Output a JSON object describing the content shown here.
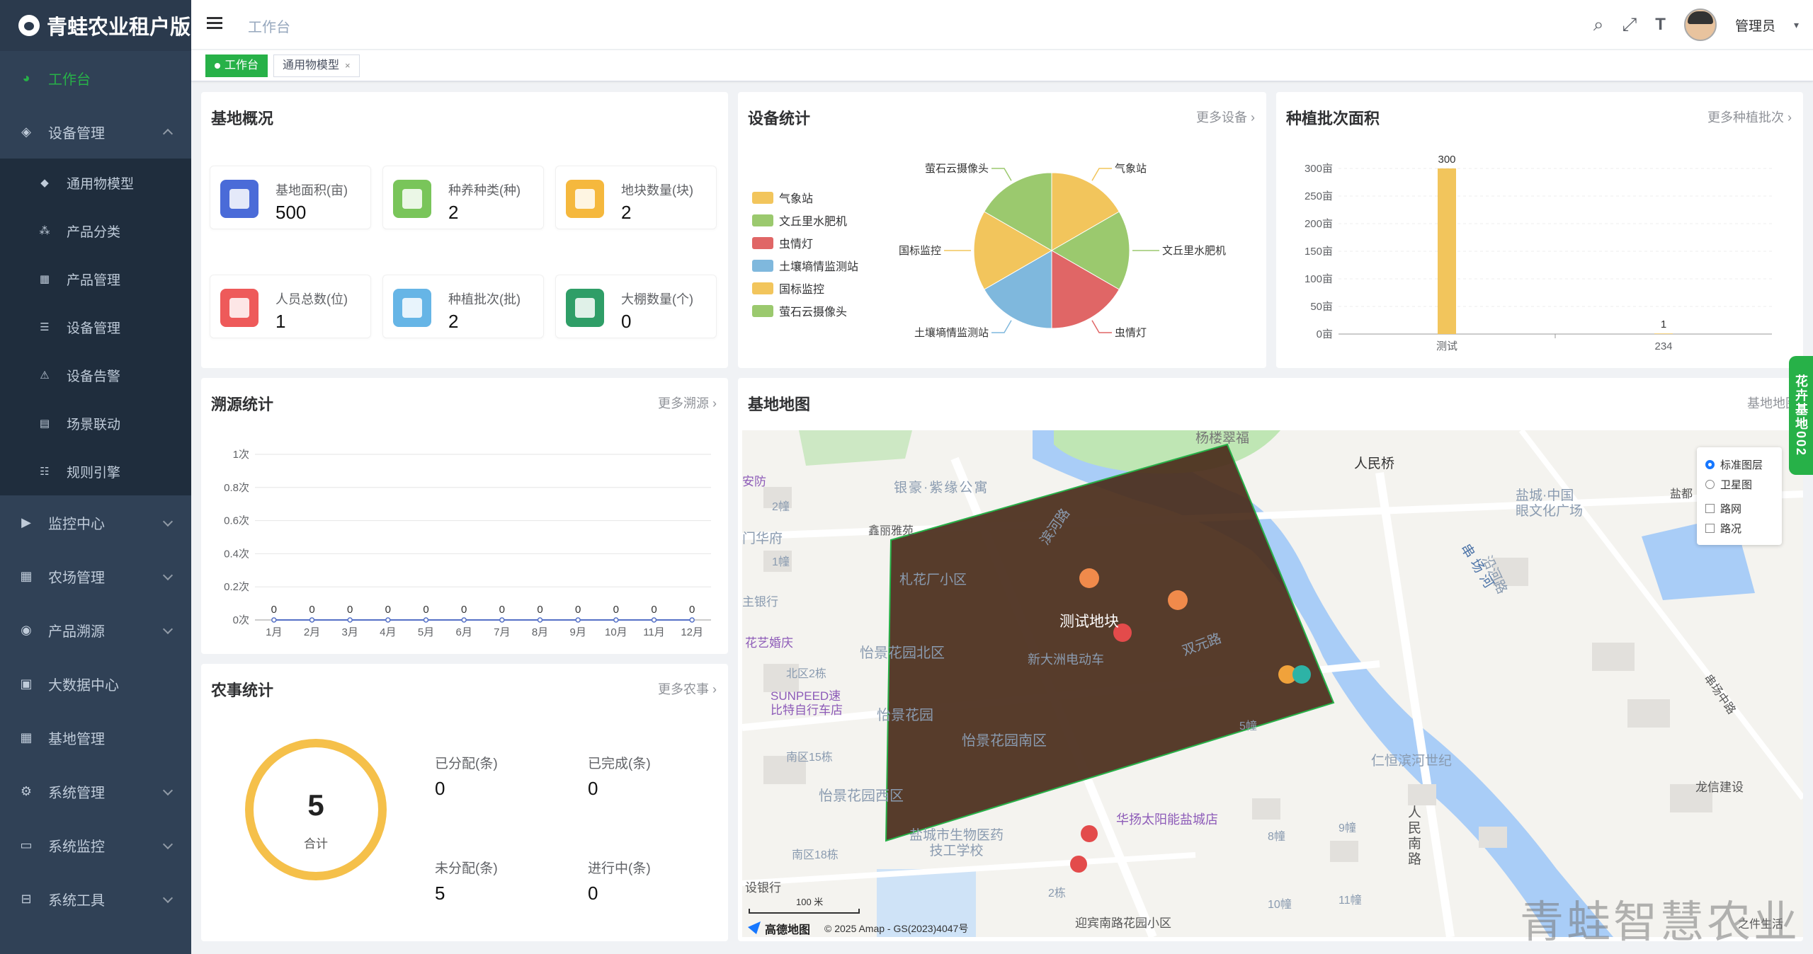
{
  "app": {
    "title": "青蛙农业租户版"
  },
  "sidebar": {
    "items": [
      {
        "label": "工作台",
        "icon": "dashboard-icon",
        "active": true
      },
      {
        "label": "设备管理",
        "icon": "layers-icon",
        "expanded": true,
        "children": [
          {
            "label": "通用物模型",
            "icon": "cube-icon"
          },
          {
            "label": "产品分类",
            "icon": "tree-icon"
          },
          {
            "label": "产品管理",
            "icon": "grid-icon"
          },
          {
            "label": "设备管理",
            "icon": "server-icon"
          },
          {
            "label": "设备告警",
            "icon": "alarm-icon"
          },
          {
            "label": "场景联动",
            "icon": "scene-icon"
          },
          {
            "label": "规则引擎",
            "icon": "rule-icon"
          }
        ]
      },
      {
        "label": "监控中心",
        "icon": "monitor-icon"
      },
      {
        "label": "农场管理",
        "icon": "farm-icon"
      },
      {
        "label": "产品溯源",
        "icon": "trace-icon"
      },
      {
        "label": "大数据中心",
        "icon": "bigdata-icon"
      },
      {
        "label": "基地管理",
        "icon": "base-icon"
      },
      {
        "label": "系统管理",
        "icon": "settings-icon"
      },
      {
        "label": "系统监控",
        "icon": "system-monitor-icon"
      },
      {
        "label": "系统工具",
        "icon": "tools-icon"
      }
    ]
  },
  "navbar": {
    "breadcrumb": "工作台",
    "username": "管理员"
  },
  "tags": [
    {
      "label": "工作台",
      "active": true
    },
    {
      "label": "通用物模型",
      "close": "×"
    }
  ],
  "overview": {
    "title": "基地概况",
    "stats": [
      {
        "label": "基地面积(亩)",
        "value": "500",
        "color": "#4a6bd8"
      },
      {
        "label": "种养种类(种)",
        "value": "2",
        "color": "#79c55a"
      },
      {
        "label": "地块数量(块)",
        "value": "2",
        "color": "#f5b83d"
      },
      {
        "label": "人员总数(位)",
        "value": "1",
        "color": "#ee5a5a"
      },
      {
        "label": "种植批次(批)",
        "value": "2",
        "color": "#66b5e6"
      },
      {
        "label": "大棚数量(个)",
        "value": "0",
        "color": "#2f9e67"
      }
    ]
  },
  "device_stats": {
    "title": "设备统计",
    "more": "更多设备",
    "legend": [
      {
        "name": "气象站",
        "color": "#f2c55c"
      },
      {
        "name": "文丘里水肥机",
        "color": "#9bc96e"
      },
      {
        "name": "虫情灯",
        "color": "#e06666"
      },
      {
        "name": "土壤墒情监测站",
        "color": "#7fb8dd"
      },
      {
        "name": "国标监控",
        "color": "#f2c55c"
      },
      {
        "name": "萤石云摄像头",
        "color": "#9bc96e"
      }
    ]
  },
  "planting": {
    "title": "种植批次面积",
    "more": "更多种植批次",
    "y_ticks": [
      "300亩",
      "250亩",
      "200亩",
      "150亩",
      "100亩",
      "50亩",
      "0亩"
    ]
  },
  "trace": {
    "title": "溯源统计",
    "more": "更多溯源",
    "y_ticks": [
      "1次",
      "0.8次",
      "0.6次",
      "0.4次",
      "0.2次",
      "0次"
    ]
  },
  "farm_work": {
    "title": "农事统计",
    "more": "更多农事",
    "total": "5",
    "total_label": "合计",
    "items": [
      {
        "label": "已分配(条)",
        "value": "0"
      },
      {
        "label": "已完成(条)",
        "value": "0"
      },
      {
        "label": "未分配(条)",
        "value": "5"
      },
      {
        "label": "进行中(条)",
        "value": "0"
      }
    ]
  },
  "base_map": {
    "title": "基地地图",
    "more": "基地地图",
    "layers": [
      {
        "label": "标准图层",
        "checked": true
      },
      {
        "label": "卫星图",
        "checked": false
      },
      {
        "label": "路网",
        "checked": false
      },
      {
        "label": "路况",
        "checked": false
      }
    ],
    "plot_label": "测试地块",
    "places": [
      "杨楼翠福",
      "人民桥",
      "银豪·紫缘公寓",
      "盐城·中国\n眼文化广场",
      "滨河路",
      "串场河",
      "沿河路",
      "札花厂小区",
      "新大洲电动车",
      "双元路",
      "怡景花园北区",
      "怡景花园",
      "怡景花园南区",
      "怡景花园西区",
      "仁恒滨河世纪",
      "华扬太阳能盐城店",
      "盐城市生物医药\n技工学校",
      "龙信建设",
      "迎宾南路花园小区",
      "SUNPEED速\n比特自行车店",
      "花艺婚庆",
      "人\n民\n南\n路",
      "串场中路",
      "北区2栋",
      "南区15栋",
      "南区18栋",
      "2栋",
      "9幢",
      "8幢",
      "10幢",
      "11幢",
      "2幢",
      "1幢",
      "5幢",
      "门华府",
      "主银行",
      "设银行",
      "安防",
      "盐都",
      "之件生活",
      "鑫丽雅苑"
    ],
    "scale": "100 米",
    "brand": "高德地图",
    "copyright": "© 2025 Amap - GS(2023)4047号"
  },
  "side_tab": "花卉基地002",
  "footer_watermark": "青蛙智慧农业",
  "chart_data": [
    {
      "type": "pie",
      "title": "设备统计",
      "labels": [
        "气象站",
        "文丘里水肥机",
        "虫情灯",
        "土壤墒情监测站",
        "国标监控",
        "萤石云摄像头"
      ],
      "values": [
        1,
        1,
        1,
        1,
        1,
        1
      ],
      "colors": [
        "#f2c55c",
        "#9bc96e",
        "#e06666",
        "#7fb8dd",
        "#f2c55c",
        "#9bc96e"
      ]
    },
    {
      "type": "bar",
      "title": "种植批次面积",
      "categories": [
        "测试",
        "234"
      ],
      "values": [
        300,
        1
      ],
      "ylim": [
        0,
        300
      ],
      "color": "#f2c55c"
    },
    {
      "type": "line",
      "title": "溯源统计",
      "categories": [
        "1月",
        "2月",
        "3月",
        "4月",
        "5月",
        "6月",
        "7月",
        "8月",
        "9月",
        "10月",
        "11月",
        "12月"
      ],
      "values": [
        0,
        0,
        0,
        0,
        0,
        0,
        0,
        0,
        0,
        0,
        0,
        0
      ],
      "ylim": [
        0,
        1
      ]
    }
  ]
}
